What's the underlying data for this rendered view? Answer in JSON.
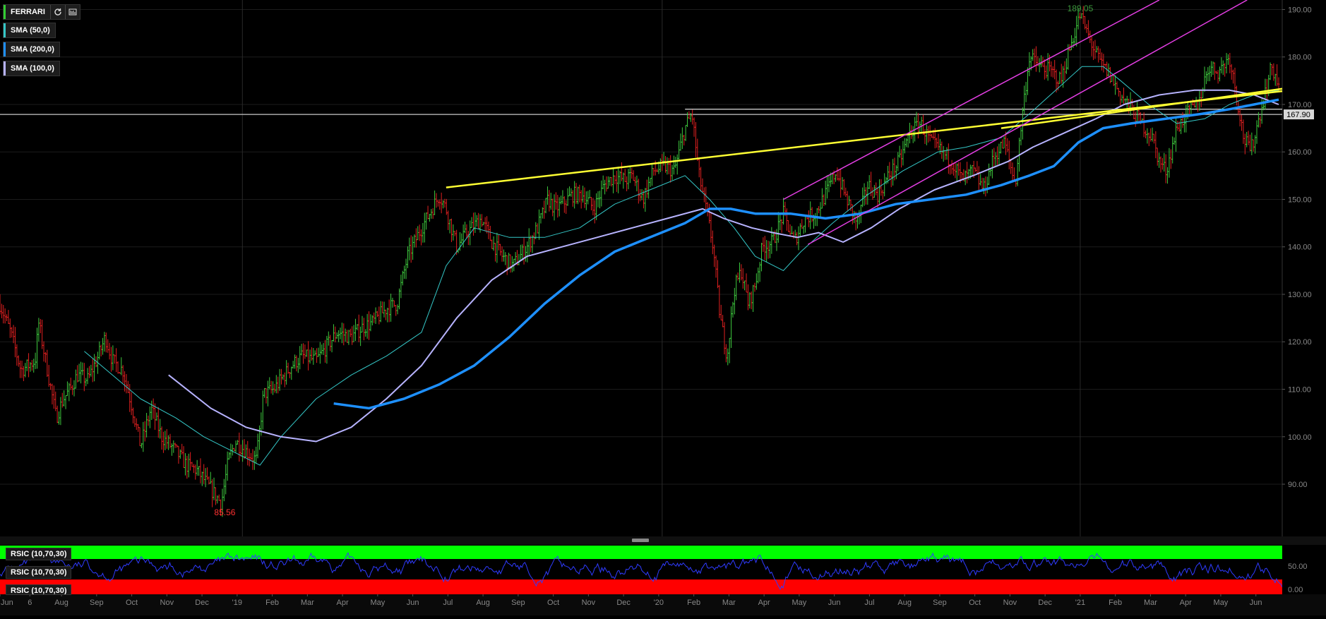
{
  "header": {
    "symbol": "FERRARI",
    "indicators": [
      {
        "label": "SMA (50,0)",
        "color": "#34c7c7"
      },
      {
        "label": "SMA (200,0)",
        "color": "#1e90ff"
      },
      {
        "label": "SMA (100,0)",
        "color": "#b7b3ff"
      }
    ],
    "refresh_icon": "refresh-icon",
    "settings_icon": "chart-settings-icon"
  },
  "rsi_panel": {
    "labels": [
      "RSIC (10,70,30)",
      "RSIC (10,70,30)",
      "RSIC (10,70,30)"
    ],
    "axis_ticks": [
      "50.00",
      "0.00"
    ],
    "overbought_color": "#00ff00",
    "oversold_color": "#ff0000",
    "line_color": "#2f3bff"
  },
  "chart_data": {
    "type": "ohlc",
    "price_axis": {
      "ticks": [
        "90.00",
        "100.00",
        "110.00",
        "120.00",
        "130.00",
        "140.00",
        "150.00",
        "160.00",
        "170.00",
        "180.00",
        "190.00"
      ],
      "ylim": [
        79,
        192
      ]
    },
    "time_axis": {
      "labels": [
        "Jun",
        "6",
        "Aug",
        "Sep",
        "Oct",
        "Nov",
        "Dec",
        "'19",
        "Feb",
        "Mar",
        "Apr",
        "May",
        "Jun",
        "Jul",
        "Aug",
        "Sep",
        "Oct",
        "Nov",
        "Dec",
        "'20",
        "Feb",
        "Mar",
        "Apr",
        "May",
        "Jun",
        "Jul",
        "Aug",
        "Sep",
        "Oct",
        "Nov",
        "Dec",
        "'21",
        "Feb",
        "Mar",
        "Apr",
        "May",
        "Jun"
      ],
      "label_months": [
        0,
        0.85,
        1.75,
        2.75,
        3.75,
        4.75,
        5.75,
        6.75,
        7.75,
        8.75,
        9.75,
        10.75,
        11.75,
        12.75,
        13.75,
        14.75,
        15.75,
        16.75,
        17.75,
        18.75,
        19.75,
        20.75,
        21.75,
        22.75,
        23.75,
        24.75,
        25.75,
        26.75,
        27.75,
        28.75,
        29.75,
        30.75,
        31.75,
        32.75,
        33.75,
        34.75,
        35.75
      ],
      "xlim": [
        0,
        36.5
      ]
    },
    "price_anchors": [
      [
        0.0,
        128
      ],
      [
        0.3,
        122
      ],
      [
        0.6,
        114
      ],
      [
        1.0,
        116
      ],
      [
        1.1,
        124
      ],
      [
        1.3,
        116
      ],
      [
        1.6,
        104
      ],
      [
        1.8,
        108
      ],
      [
        2.0,
        110
      ],
      [
        2.2,
        113
      ],
      [
        2.5,
        112
      ],
      [
        2.8,
        117
      ],
      [
        3.0,
        121
      ],
      [
        3.2,
        116
      ],
      [
        3.5,
        114
      ],
      [
        3.8,
        105
      ],
      [
        4.0,
        98
      ],
      [
        4.3,
        106
      ],
      [
        4.6,
        100
      ],
      [
        5.0,
        97
      ],
      [
        5.3,
        94
      ],
      [
        5.6,
        93
      ],
      [
        5.9,
        90
      ],
      [
        6.1,
        88
      ],
      [
        6.3,
        86
      ],
      [
        6.5,
        95
      ],
      [
        6.7,
        99
      ],
      [
        7.0,
        97
      ],
      [
        7.3,
        95
      ],
      [
        7.5,
        109
      ],
      [
        7.8,
        110
      ],
      [
        8.0,
        112
      ],
      [
        8.3,
        115
      ],
      [
        8.6,
        117
      ],
      [
        9.0,
        116
      ],
      [
        9.3,
        119
      ],
      [
        9.6,
        122
      ],
      [
        10.0,
        121
      ],
      [
        10.3,
        123
      ],
      [
        10.6,
        124
      ],
      [
        11.0,
        127
      ],
      [
        11.3,
        128
      ],
      [
        11.6,
        138
      ],
      [
        12.0,
        144
      ],
      [
        12.3,
        148
      ],
      [
        12.5,
        151
      ],
      [
        12.7,
        148
      ],
      [
        13.0,
        140
      ],
      [
        13.3,
        143
      ],
      [
        13.7,
        146
      ],
      [
        14.0,
        141
      ],
      [
        14.3,
        138
      ],
      [
        14.6,
        136
      ],
      [
        15.0,
        140
      ],
      [
        15.3,
        144
      ],
      [
        15.6,
        150
      ],
      [
        15.8,
        148
      ],
      [
        16.0,
        149
      ],
      [
        16.3,
        151
      ],
      [
        16.6,
        151
      ],
      [
        16.9,
        148
      ],
      [
        17.2,
        153
      ],
      [
        17.5,
        155
      ],
      [
        17.8,
        154
      ],
      [
        18.0,
        155
      ],
      [
        18.3,
        150
      ],
      [
        18.6,
        156
      ],
      [
        18.9,
        157
      ],
      [
        19.2,
        156
      ],
      [
        19.5,
        165
      ],
      [
        19.7,
        168
      ],
      [
        19.9,
        155
      ],
      [
        20.1,
        148
      ],
      [
        20.3,
        140
      ],
      [
        20.5,
        125
      ],
      [
        20.7,
        117
      ],
      [
        20.9,
        131
      ],
      [
        21.1,
        135
      ],
      [
        21.3,
        128
      ],
      [
        21.5,
        132
      ],
      [
        21.7,
        140
      ],
      [
        22.0,
        141
      ],
      [
        22.3,
        147
      ],
      [
        22.6,
        141
      ],
      [
        22.9,
        146
      ],
      [
        23.2,
        147
      ],
      [
        23.5,
        151
      ],
      [
        23.8,
        156
      ],
      [
        24.1,
        150
      ],
      [
        24.4,
        145
      ],
      [
        24.7,
        153
      ],
      [
        25.0,
        151
      ],
      [
        25.3,
        155
      ],
      [
        25.6,
        158
      ],
      [
        25.9,
        164
      ],
      [
        26.2,
        166
      ],
      [
        26.5,
        162
      ],
      [
        26.8,
        160
      ],
      [
        27.1,
        158
      ],
      [
        27.4,
        154
      ],
      [
        27.7,
        156
      ],
      [
        28.0,
        152
      ],
      [
        28.3,
        159
      ],
      [
        28.6,
        162
      ],
      [
        28.9,
        153
      ],
      [
        29.1,
        168
      ],
      [
        29.3,
        180
      ],
      [
        29.6,
        178
      ],
      [
        29.9,
        177
      ],
      [
        30.2,
        175
      ],
      [
        30.5,
        183
      ],
      [
        30.75,
        189
      ],
      [
        31.0,
        184
      ],
      [
        31.3,
        179
      ],
      [
        31.6,
        176
      ],
      [
        31.9,
        172
      ],
      [
        32.2,
        169
      ],
      [
        32.5,
        166
      ],
      [
        32.8,
        163
      ],
      [
        33.0,
        158
      ],
      [
        33.2,
        156
      ],
      [
        33.5,
        165
      ],
      [
        33.8,
        168
      ],
      [
        34.1,
        170
      ],
      [
        34.4,
        178
      ],
      [
        34.7,
        177
      ],
      [
        35.0,
        180
      ],
      [
        35.2,
        172
      ],
      [
        35.4,
        163
      ],
      [
        35.6,
        160
      ],
      [
        35.8,
        166
      ],
      [
        36.0,
        172
      ],
      [
        36.2,
        178
      ],
      [
        36.4,
        174
      ]
    ],
    "sma_50": [
      [
        2.4,
        118
      ],
      [
        3.2,
        113
      ],
      [
        4.0,
        108
      ],
      [
        5.0,
        104
      ],
      [
        5.8,
        100
      ],
      [
        6.6,
        97
      ],
      [
        7.4,
        94
      ],
      [
        8.0,
        100
      ],
      [
        9.0,
        108
      ],
      [
        10.0,
        113
      ],
      [
        11.0,
        117
      ],
      [
        12.0,
        122
      ],
      [
        12.7,
        136
      ],
      [
        13.5,
        144
      ],
      [
        14.5,
        142
      ],
      [
        15.5,
        142
      ],
      [
        16.5,
        144
      ],
      [
        17.5,
        149
      ],
      [
        18.5,
        152
      ],
      [
        19.5,
        155
      ],
      [
        20.2,
        150
      ],
      [
        20.9,
        144
      ],
      [
        21.5,
        138
      ],
      [
        22.3,
        135
      ],
      [
        22.8,
        139
      ],
      [
        23.7,
        145
      ],
      [
        24.7,
        151
      ],
      [
        25.7,
        156
      ],
      [
        26.7,
        160
      ],
      [
        27.5,
        161
      ],
      [
        28.5,
        163
      ],
      [
        29.3,
        168
      ],
      [
        30.2,
        174
      ],
      [
        30.8,
        178
      ],
      [
        31.4,
        178
      ],
      [
        31.9,
        175
      ],
      [
        32.7,
        170
      ],
      [
        33.5,
        166
      ],
      [
        34.3,
        167
      ],
      [
        35.0,
        170
      ],
      [
        35.7,
        172
      ],
      [
        36.4,
        173
      ]
    ],
    "sma_100": [
      [
        4.8,
        113
      ],
      [
        6.0,
        106
      ],
      [
        7.0,
        102
      ],
      [
        8.0,
        100
      ],
      [
        9.0,
        99
      ],
      [
        10.0,
        102
      ],
      [
        11.0,
        108
      ],
      [
        12.0,
        115
      ],
      [
        13.0,
        125
      ],
      [
        14.0,
        133
      ],
      [
        15.0,
        138
      ],
      [
        16.0,
        140
      ],
      [
        17.0,
        142
      ],
      [
        18.0,
        144
      ],
      [
        19.0,
        146
      ],
      [
        20.0,
        148
      ],
      [
        20.6,
        146
      ],
      [
        21.4,
        144
      ],
      [
        22.0,
        143
      ],
      [
        22.7,
        142
      ],
      [
        23.3,
        143
      ],
      [
        24.0,
        141
      ],
      [
        24.8,
        144
      ],
      [
        25.6,
        148
      ],
      [
        26.6,
        152
      ],
      [
        27.7,
        155
      ],
      [
        28.7,
        158
      ],
      [
        29.4,
        161
      ],
      [
        30.3,
        164
      ],
      [
        31.2,
        167
      ],
      [
        32.0,
        170
      ],
      [
        33.0,
        172
      ],
      [
        34.0,
        173
      ],
      [
        35.0,
        173
      ],
      [
        35.7,
        172
      ],
      [
        36.4,
        170
      ]
    ],
    "sma_200": [
      [
        9.5,
        107
      ],
      [
        10.5,
        106
      ],
      [
        11.5,
        108
      ],
      [
        12.5,
        111
      ],
      [
        13.5,
        115
      ],
      [
        14.5,
        121
      ],
      [
        15.5,
        128
      ],
      [
        16.5,
        134
      ],
      [
        17.5,
        139
      ],
      [
        18.5,
        142
      ],
      [
        19.5,
        145
      ],
      [
        20.2,
        148
      ],
      [
        20.8,
        148
      ],
      [
        21.5,
        147
      ],
      [
        22.5,
        147
      ],
      [
        23.5,
        146
      ],
      [
        24.5,
        147
      ],
      [
        25.5,
        149
      ],
      [
        26.5,
        150
      ],
      [
        27.5,
        151
      ],
      [
        28.5,
        153
      ],
      [
        29.3,
        155
      ],
      [
        30.0,
        157
      ],
      [
        30.7,
        162
      ],
      [
        31.4,
        165
      ],
      [
        32.2,
        166
      ],
      [
        33.2,
        167
      ],
      [
        34.2,
        168
      ],
      [
        35.0,
        169
      ],
      [
        35.7,
        170
      ],
      [
        36.4,
        171
      ]
    ],
    "annotations": [
      {
        "text": "189.05",
        "x": 30.75,
        "y": 189.05,
        "color": "#3d9a3d",
        "position": "above"
      },
      {
        "text": "85.56",
        "x": 6.4,
        "y": 85.56,
        "color": "#ff3030",
        "position": "below"
      }
    ],
    "current_price_label": "167.90",
    "horizontal_lines": [
      {
        "y": 167.9,
        "color": "#c8c8c8"
      },
      {
        "y": 169.0,
        "color": "#c8c8c8",
        "from_x": 19.5
      }
    ],
    "trendlines": [
      {
        "color": "#ffff33",
        "from": [
          12.7,
          152.5
        ],
        "to": [
          36.5,
          172.8
        ]
      },
      {
        "color": "#ffff33",
        "from": [
          28.5,
          165
        ],
        "to": [
          36.5,
          173.3
        ]
      },
      {
        "color": "#e43ee4",
        "from": [
          22.3,
          150
        ],
        "to": [
          33.0,
          192
        ]
      },
      {
        "color": "#e43ee4",
        "from": [
          23.0,
          140.5
        ],
        "to": [
          35.5,
          192
        ]
      }
    ]
  }
}
